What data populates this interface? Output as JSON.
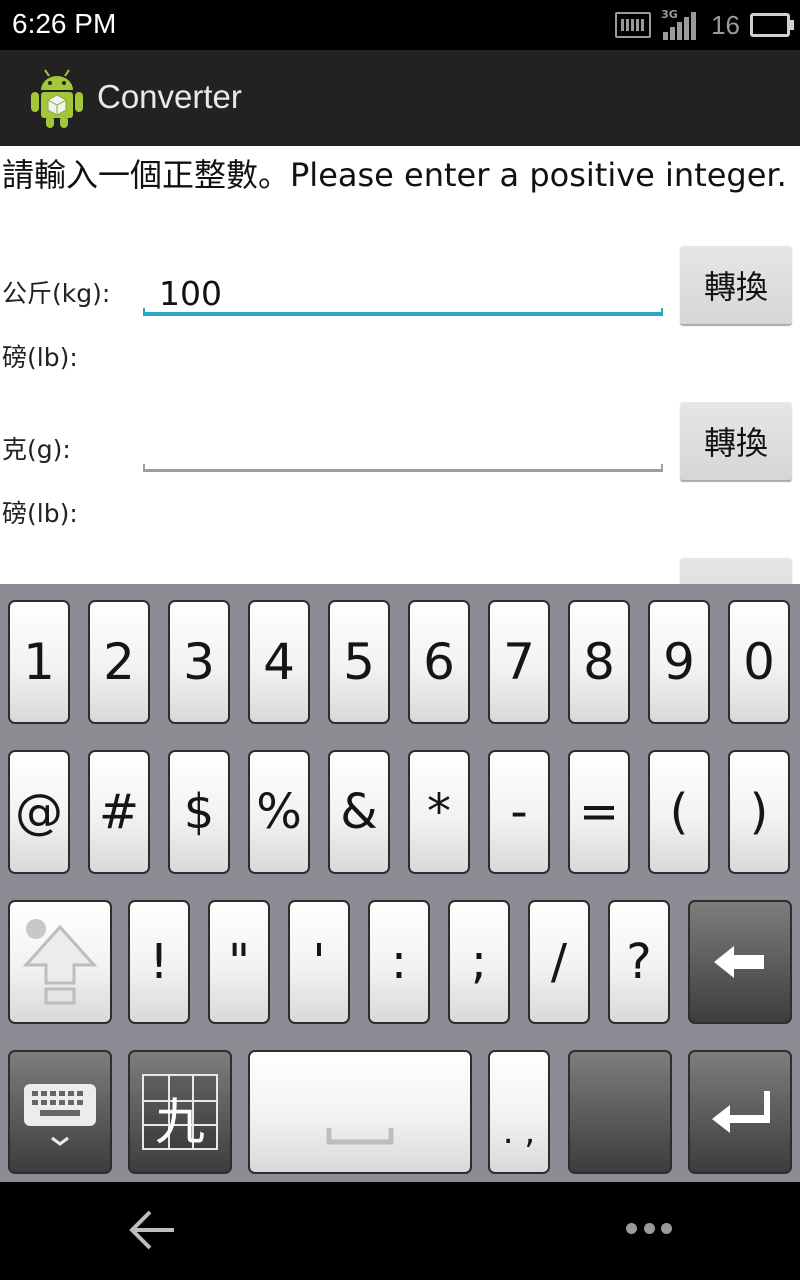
{
  "status_bar": {
    "time": "6:26 PM",
    "network": "3G",
    "battery_level": "16"
  },
  "action_bar": {
    "title": "Converter",
    "icon": "android-robot-icon"
  },
  "form": {
    "instructions": "請輸入一個正整數。Please enter a positive integer.",
    "rows": [
      {
        "input_label": "公斤(kg):",
        "input_value": "100",
        "button_label": "轉換",
        "result_label": "磅(lb):"
      },
      {
        "input_label": "克(g):",
        "input_value": "",
        "button_label": "轉換",
        "result_label": "磅(lb):"
      }
    ]
  },
  "keyboard": {
    "row1": [
      "1",
      "2",
      "3",
      "4",
      "5",
      "6",
      "7",
      "8",
      "9",
      "0"
    ],
    "row2": [
      "@",
      "#",
      "$",
      "%",
      "&",
      "*",
      "-",
      "=",
      "(",
      ")"
    ],
    "row3": [
      "!",
      "\"",
      "'",
      ":",
      ";",
      "/",
      "?"
    ],
    "row4_period_comma": ". ,",
    "special_keys": {
      "shift": "shift-arrow-icon",
      "backspace": "backspace-arrow-icon",
      "keyboard_switch": "keyboard-switch-icon",
      "handwriting": "handwriting-grid-icon",
      "space": "space-bar-icon",
      "enter": "enter-arrow-icon"
    },
    "handwriting_char": "九"
  },
  "nav_bar": {
    "back": "back-arrow-icon",
    "menu": "overflow-menu-icon"
  },
  "colors": {
    "focus_underline": "#2aa7c6",
    "action_bar_bg": "#222222",
    "keyboard_bg": "#8c8c94"
  }
}
